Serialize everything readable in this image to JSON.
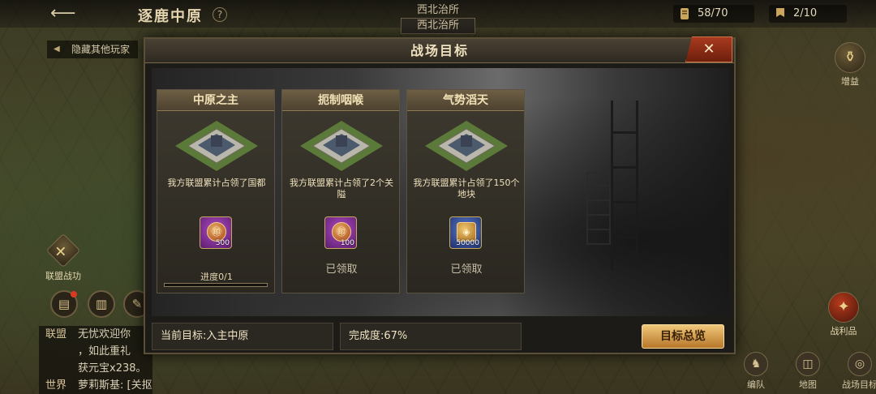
{
  "header": {
    "back_icon": "back-arrow-icon",
    "map_title": "逐鹿中原",
    "help_icon": "question-icon",
    "center_title": "西北治所",
    "sub_tag": "西北治所",
    "resources": [
      {
        "icon": "scroll-icon",
        "value": "58/70"
      },
      {
        "icon": "banner-icon",
        "value": "2/10"
      }
    ]
  },
  "hide_others_label": "隐藏其他玩家",
  "side": {
    "gain_label": "增益",
    "loot_label": "战利品",
    "alliance_war_label": "联盟战功"
  },
  "bottom_tools": [
    {
      "icon": "troops-icon",
      "label": "编队"
    },
    {
      "icon": "map-icon",
      "label": "地图"
    },
    {
      "icon": "target-icon",
      "label": "战场目标"
    }
  ],
  "chat": {
    "rows": [
      {
        "channel": "联盟",
        "text": "无忧欢迎你"
      },
      {
        "channel": "",
        "text": "，如此重礼"
      },
      {
        "channel": "",
        "text": "获元宝x238。"
      },
      {
        "channel": "世界",
        "text": "萝莉斯基: [关抠鼻]"
      }
    ]
  },
  "modal": {
    "title": "战场目标",
    "close_label": "✕",
    "cards": [
      {
        "title": "中原之主",
        "desc": "我方联盟累计占领了国都",
        "reward_color": "purple",
        "reward_qty": "500",
        "status": "",
        "progress_label": "进度0/1",
        "progress": 0
      },
      {
        "title": "扼制咽喉",
        "desc": "我方联盟累计占领了2个关隘",
        "reward_color": "purple",
        "reward_qty": "100",
        "status": "已领取",
        "progress_label": "",
        "progress": null
      },
      {
        "title": "气势滔天",
        "desc": "我方联盟累计占领了150个地块",
        "reward_color": "blue",
        "reward_qty": "50000",
        "status": "已领取",
        "progress_label": "",
        "progress": null
      }
    ],
    "current_goal": "当前目标:入主中原",
    "completion": "完成度:67%",
    "overview_button": "目标总览"
  },
  "colors": {
    "accent_gold": "#d9a94a",
    "close_red": "#a83a1e",
    "reward_purple": "#b04ac4",
    "reward_blue": "#5c7ed0"
  }
}
